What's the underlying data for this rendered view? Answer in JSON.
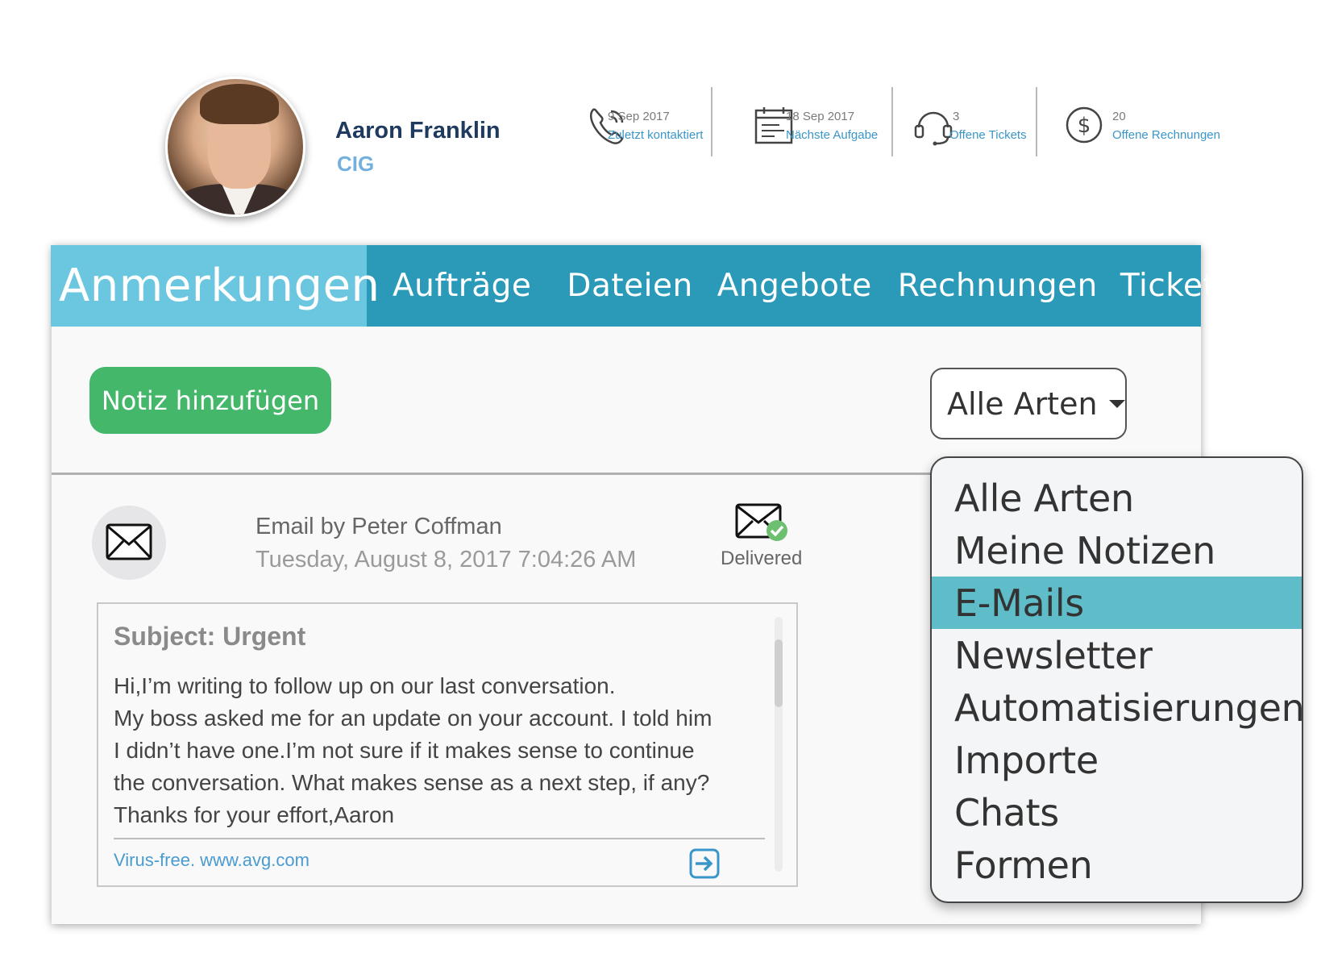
{
  "contact": {
    "name": "Aaron Franklin",
    "company": "CIG"
  },
  "stats": [
    {
      "icon": "phone-icon",
      "value": "9 Sep 2017",
      "label": "Zuletzt kontaktiert"
    },
    {
      "icon": "calendar-icon",
      "value": "18 Sep 2017",
      "label": "Nächste Aufgabe"
    },
    {
      "icon": "headset-icon",
      "value": "3",
      "label": "Offene Tickets"
    },
    {
      "icon": "dollar-icon",
      "value": "20",
      "label": "Offene Rechnungen"
    }
  ],
  "tabs": {
    "active": "Anmerkungen",
    "items": [
      "Aufträge",
      "Dateien",
      "Angebote",
      "Rechnungen",
      "Tickets"
    ]
  },
  "toolbar": {
    "add_note_label": "Notiz hinzufügen",
    "type_filter_value": "Alle Arten"
  },
  "note": {
    "icon": "envelope-icon",
    "author_line": "Email by Peter Coffman",
    "date": "Tuesday, August 8, 2017 7:04:26 AM",
    "status": "Delivered",
    "subject": "Subject: Urgent",
    "body": [
      "Hi,I’m writing to follow up on our last conversation.",
      "My boss asked me for an update on your account. I told him",
      "I didn’t have one.I’m not sure if it makes sense to continue",
      "the conversation. What makes sense as a next step, if any?",
      "Thanks for your effort,Aaron"
    ],
    "footer_link": "Virus-free. www.avg.com"
  },
  "dropdown": {
    "options": [
      "Alle Arten",
      "Meine Notizen",
      "E-Mails",
      "Newsletter",
      "Automatisierungen",
      "Importe",
      "Chats",
      "Formen"
    ],
    "highlighted": "E-Mails"
  },
  "colors": {
    "tab_bar": "#2b9ab8",
    "tab_active": "#6bc6df",
    "add_button": "#44b76a",
    "dropdown_highlight": "#5fbcc9",
    "link": "#4a9bd0",
    "name": "#1f3a5f"
  }
}
